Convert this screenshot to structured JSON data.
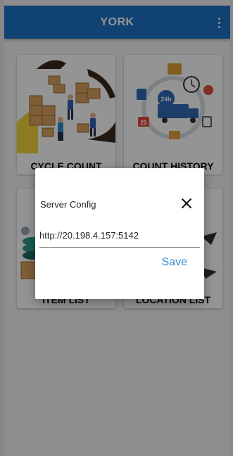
{
  "app_bar": {
    "title": "YORK",
    "menu_icon": "more-vert-icon",
    "background": "#1d74c9"
  },
  "tiles": [
    {
      "label": "CYCLE COUNT",
      "icon": "warehouse-workers-boxes-illustration"
    },
    {
      "label": "COUNT HISTORY",
      "icon": "delivery-truck-logistics-illustration"
    },
    {
      "label": "ITEM LIST",
      "icon": "items-stack-illustration"
    },
    {
      "label": "LOCATION LIST",
      "icon": "location-arrows-illustration"
    }
  ],
  "dialog": {
    "title": "Server Config",
    "url_value": "http://20.198.4.157:5142",
    "save_label": "Save",
    "close_icon": "close-icon",
    "accent": "#2f8fd8"
  }
}
